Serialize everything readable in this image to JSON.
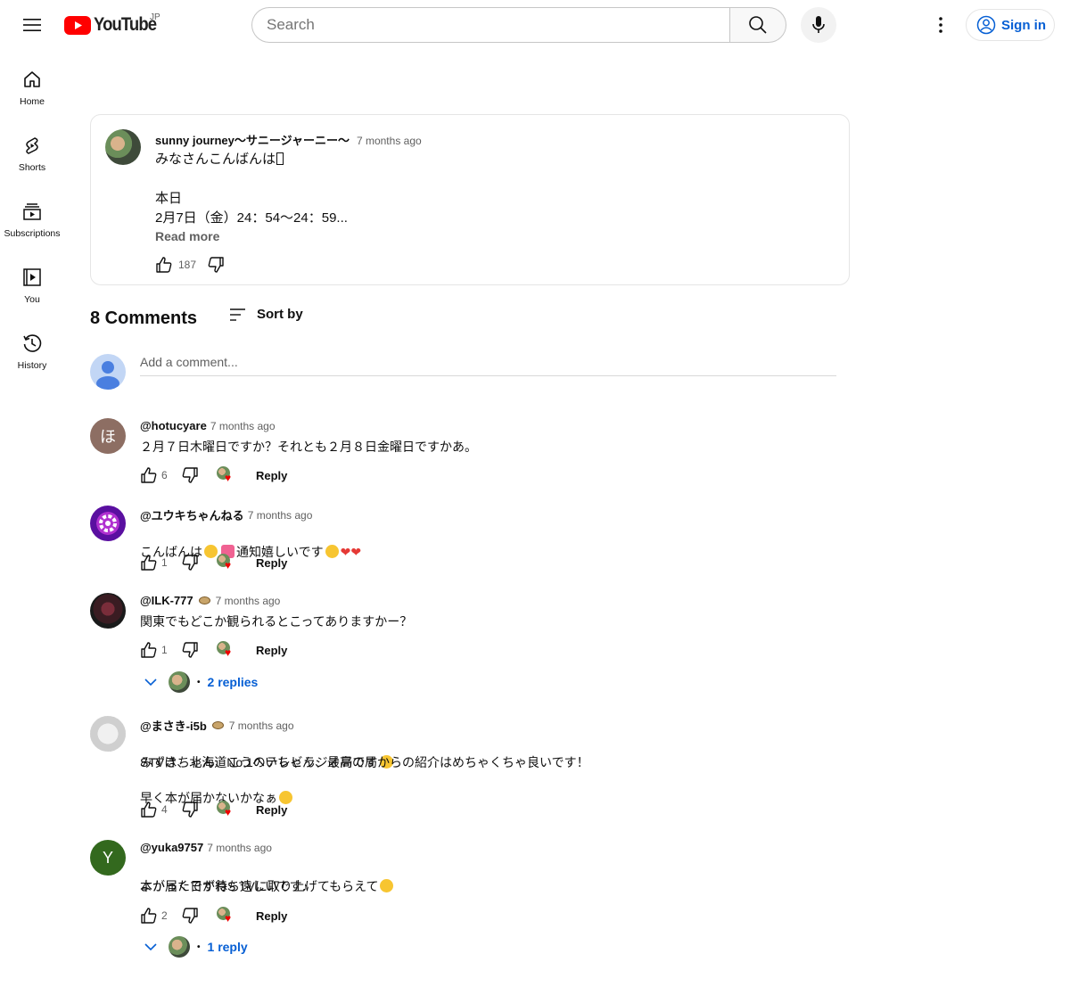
{
  "header": {
    "logo_text": "YouTube",
    "country_code": "JP",
    "search_placeholder": "Search",
    "signin_label": "Sign in"
  },
  "sidebar": {
    "items": [
      {
        "label": "Home",
        "icon": "home-icon"
      },
      {
        "label": "Shorts",
        "icon": "shorts-icon"
      },
      {
        "label": "Subscriptions",
        "icon": "subscriptions-icon"
      },
      {
        "label": "You",
        "icon": "you-icon"
      },
      {
        "label": "History",
        "icon": "history-icon"
      }
    ]
  },
  "post": {
    "author": "sunny journey〜サニージャーニー〜",
    "time": "7 months ago",
    "line1": "みなさんこんばんは",
    "line2": "本日",
    "line3": "2月7日（金）24：54〜24：59...",
    "read_more": "Read more",
    "likes": "187"
  },
  "comments_section": {
    "title": "8 Comments",
    "sort_label": "Sort by",
    "add_placeholder": "Add a comment..."
  },
  "comments": [
    {
      "handle": "@hotucyare",
      "time": "7 months ago",
      "avatar_letter": "ほ",
      "avatar_color": "#8d6e63",
      "text": "２月７日木曜日ですか？それとも２月８日金曜日ですかあ。",
      "likes": "6",
      "reply_label": "Reply"
    },
    {
      "handle": "@ユウキちゃんねる",
      "time": "7 months ago",
      "text_a": "こんばんは",
      "text_b": "通知嬉しいです",
      "likes": "1",
      "reply_label": "Reply"
    },
    {
      "handle": "@ILK-777",
      "time": "7 months ago",
      "text": "関東でもどこか観られるとこってありますかー？",
      "likes": "1",
      "reply_label": "Reply",
      "replies": "2 replies"
    },
    {
      "handle": "@まさき-i5b",
      "time": "7 months ago",
      "text_1": "STVは、北海道No.1のテレビラジオ局です",
      "text_2": "みずきちゃん、こうへいちゃん、最高の局からの紹介はめちゃくちゃ良いです！",
      "text_3": "早く本が届かないかなぁ",
      "likes": "4",
      "reply_label": "Reply"
    },
    {
      "handle": "@yuka9757",
      "time": "7 months ago",
      "avatar_letter": "Y",
      "avatar_color": "#33691e",
      "text_1": "よかったですねS TVに取り上げてもらえて",
      "text_2": "本が届く日が待ち遠しいです♪",
      "likes": "2",
      "reply_label": "Reply",
      "replies": "1 reply"
    }
  ]
}
